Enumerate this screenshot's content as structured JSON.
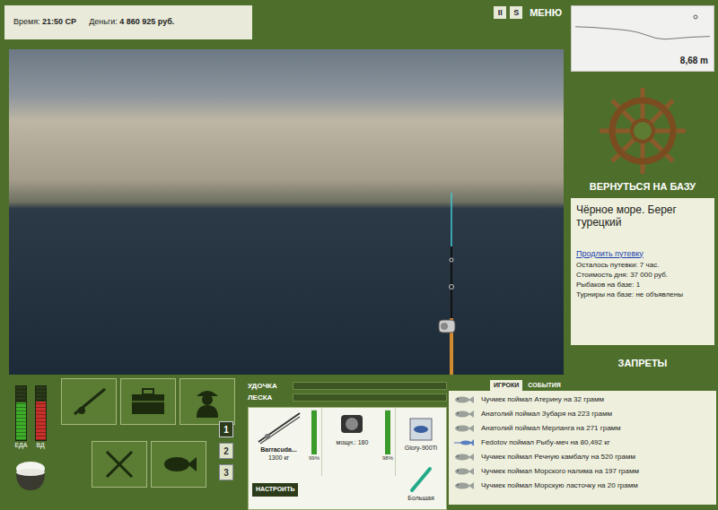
{
  "status": {
    "time_label": "Время:",
    "time": "21:50 СР",
    "money_label": "Деньги:",
    "money": "4 860 925 руб."
  },
  "top_buttons": [
    {
      "label": "II",
      "kind": "box"
    },
    {
      "label": "S",
      "kind": "box"
    },
    {
      "label": "МЕНЮ",
      "kind": "text"
    }
  ],
  "depth": {
    "reading": "8,68 m",
    "profile": [
      5.2,
      5.3,
      5.4,
      5.6,
      5.8,
      6.0,
      6.3,
      6.8,
      7.6,
      8.4,
      8.68,
      8.5,
      8.3,
      8.1,
      8.0,
      7.9
    ]
  },
  "base": {
    "action": "ВЕРНУТЬСЯ НА БАЗУ",
    "location": "Чёрное море. Берег турецкий",
    "extend_link": "Продлить путевку",
    "lines": [
      "Осталось путевки: 7 час.",
      "Стоимость дня: 37 000 руб.",
      "Рыбаков на базе: 1",
      "Турниры на базе: не объявлены"
    ],
    "bans": "ЗАПРЕТЫ"
  },
  "meters": [
    {
      "label": "ЕДА",
      "level": 0.7,
      "color": "#3fae2a"
    },
    {
      "label": "ВД",
      "level": 0.72,
      "color": "#c8302a"
    }
  ],
  "slots": [
    {
      "label": "1",
      "selected": true
    },
    {
      "label": "2",
      "selected": false
    },
    {
      "label": "3",
      "selected": false
    }
  ],
  "tension": [
    {
      "label": "УДОЧКА",
      "level": 0
    },
    {
      "label": "ЛЕСКА",
      "level": 0
    }
  ],
  "gear": [
    {
      "kind": "rod",
      "name": "Barracuda...",
      "detail": "1300 кг",
      "condition": "99%",
      "level": 0.99,
      "button": "НАСТРОИТЬ"
    },
    {
      "kind": "reel",
      "name": "",
      "detail": "мощн.: 180",
      "condition": "98%",
      "level": 0.98,
      "button": ""
    },
    {
      "kind": "lure",
      "name": "Glory-900Ti",
      "detail": "",
      "condition": "",
      "level": 0,
      "button": ""
    },
    {
      "kind": "bait",
      "name": "Большая",
      "detail": "",
      "condition": "",
      "level": 0,
      "button": ""
    }
  ],
  "feed": {
    "tabs": [
      {
        "label": "ИГРОКИ",
        "selected": true
      },
      {
        "label": "СОБЫТИЯ",
        "selected": false
      }
    ],
    "items": [
      {
        "text": "Чучмек поймал Атерину на 32 грамм",
        "kind": "fish"
      },
      {
        "text": "Анатолий поймал Зубаря на 223 грамм",
        "kind": "fish"
      },
      {
        "text": "Анатолий поймал Мерланга на 271 грамм",
        "kind": "fish"
      },
      {
        "text": "Fedotov поймал Рыбу-меч на 80,492 кг",
        "kind": "swordfish"
      },
      {
        "text": "Чучмек поймал Речную камбалу на 520 грамм",
        "kind": "fish"
      },
      {
        "text": "Чучмек поймал Морского налима на 197 грамм",
        "kind": "fish"
      },
      {
        "text": "Чучмек поймал Морскую ласточку на 20 грамм",
        "kind": "fish"
      }
    ]
  }
}
